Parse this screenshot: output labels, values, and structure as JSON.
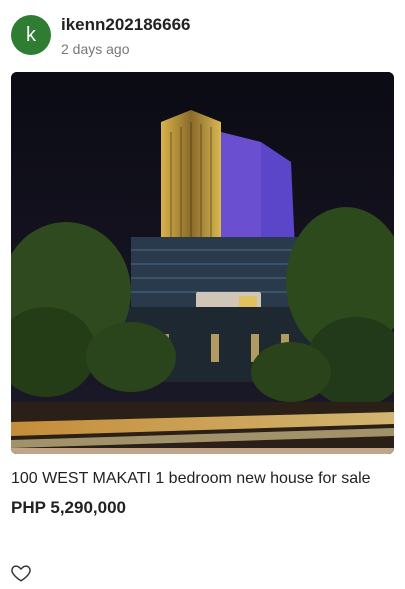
{
  "post": {
    "avatar_letter": "k",
    "avatar_color": "#2e7d32",
    "username": "ikenn202186666",
    "time_ago": "2 days ago"
  },
  "listing": {
    "image_icon": "building-photo",
    "title": "100 WEST MAKATI 1 bedroom new house for sale",
    "price": "PHP 5,290,000"
  },
  "actions": {
    "like_icon": "heart-outline-icon"
  }
}
